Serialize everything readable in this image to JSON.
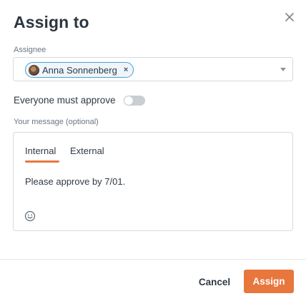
{
  "dialog": {
    "title": "Assign to",
    "close_icon": "close-icon"
  },
  "assignee": {
    "label": "Assignee",
    "selected": [
      {
        "name": "Anna Sonnenberg",
        "remove_icon": "×"
      }
    ],
    "dropdown_icon": "chevron-down-icon"
  },
  "approval": {
    "label": "Everyone must approve",
    "enabled": false
  },
  "message": {
    "label": "Your message (optional)",
    "tabs": [
      {
        "label": "Internal",
        "active": true
      },
      {
        "label": "External",
        "active": false
      }
    ],
    "text": "Please approve by 7/01.",
    "emoji_icon": "smiley-icon"
  },
  "footer": {
    "cancel_label": "Cancel",
    "assign_label": "Assign"
  },
  "colors": {
    "accent": "#e8773e",
    "chip_border": "#4a9fd8",
    "toggle_off": "#c9ced3"
  }
}
